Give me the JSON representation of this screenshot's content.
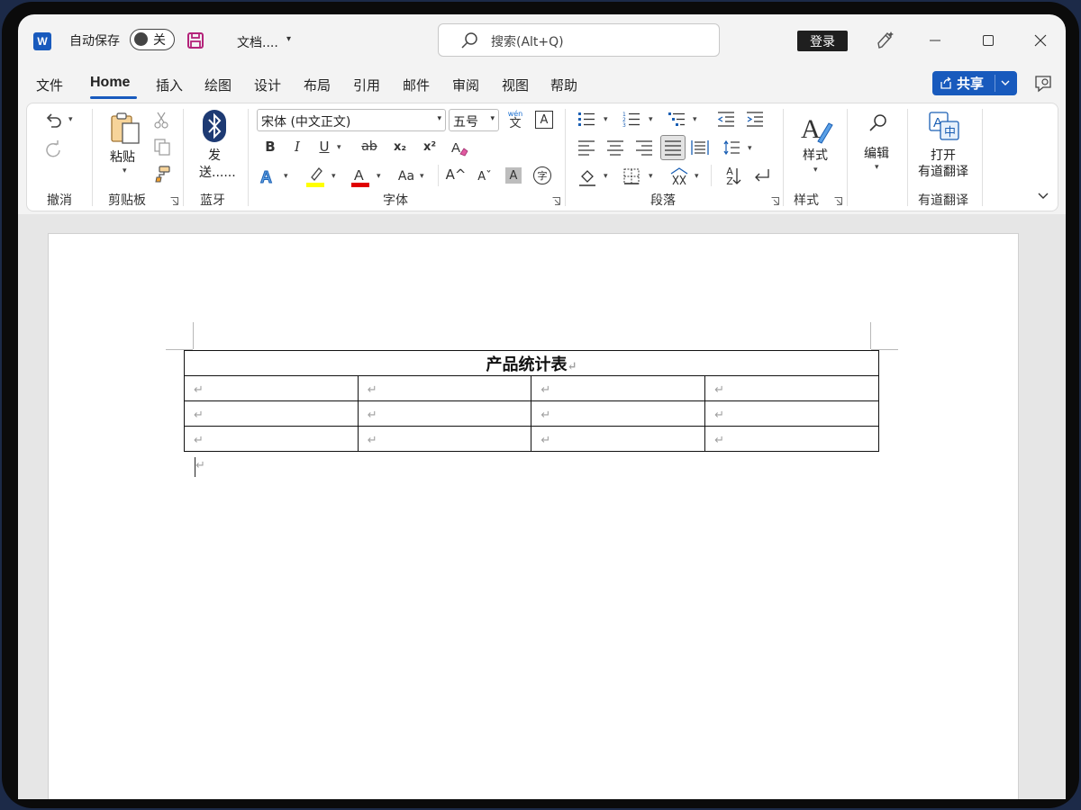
{
  "titlebar": {
    "app_icon_letter": "W",
    "autosave_label": "自动保存",
    "autosave_state": "关",
    "doc_title": "文档....",
    "search_placeholder": "搜索(Alt+Q)",
    "login_label": "登录"
  },
  "menu": {
    "items": [
      "文件",
      "Home",
      "插入",
      "绘图",
      "设计",
      "布局",
      "引用",
      "邮件",
      "审阅",
      "视图",
      "帮助"
    ],
    "active": "Home",
    "share_label": "共享"
  },
  "ribbon": {
    "groups": {
      "undo": "撤消",
      "clipboard": "剪贴板",
      "bluetooth": "蓝牙",
      "font": "字体",
      "paragraph": "段落",
      "styles": "样式",
      "youdao": "有道翻译"
    },
    "paste_label": "粘贴",
    "bluetooth_send_line1": "发",
    "bluetooth_send_line2": "送......",
    "font_name": "宋体 (中文正文)",
    "font_size": "五号",
    "styles_label": "样式",
    "editing_label": "编辑",
    "youdao_line1": "打开",
    "youdao_line2": "有道翻译",
    "bold": "B",
    "italic": "I",
    "underline": "U",
    "strike": "ab",
    "subscript": "x₂",
    "superscript": "x²",
    "grow_font": "A^",
    "shrink_font": "Aˇ",
    "change_case": "Aa",
    "char_shading": "A",
    "phonetic_top": "wén",
    "phonetic_bottom": "文",
    "char_border": "A",
    "enclose_char": "字",
    "sort_top": "A",
    "sort_bottom": "Z",
    "highlight_color": "#ffff00",
    "font_color": "#e00000"
  },
  "document": {
    "table_title": "产品统计表",
    "para_mark": "↵",
    "rows": [
      [
        "",
        "",
        "",
        ""
      ],
      [
        "",
        "",
        "",
        ""
      ],
      [
        "",
        "",
        "",
        ""
      ]
    ]
  }
}
